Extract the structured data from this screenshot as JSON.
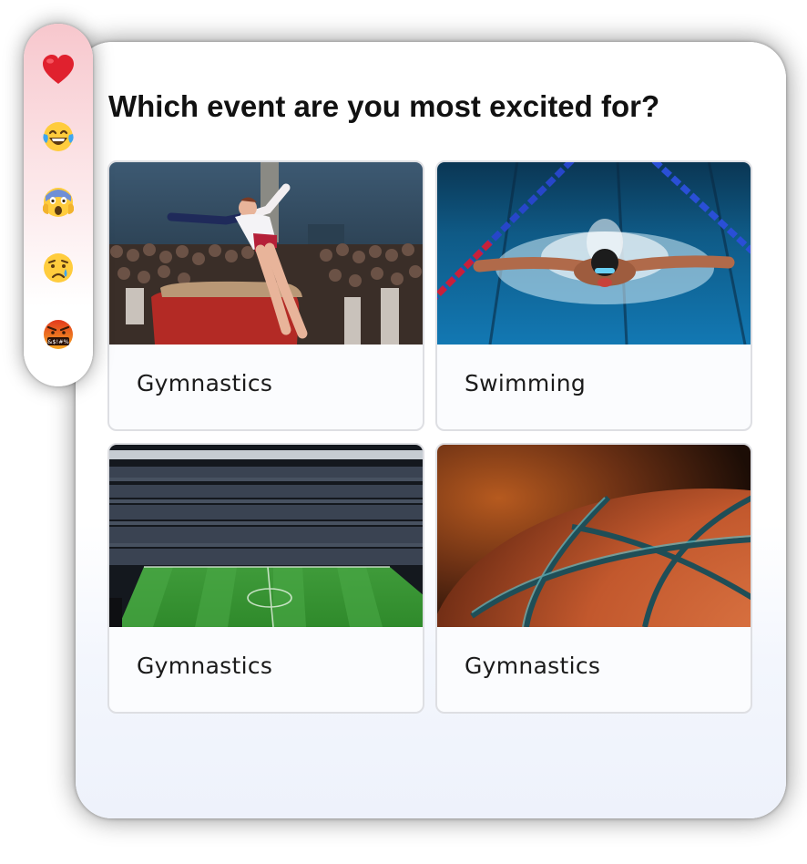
{
  "poll": {
    "question": "Which event are you most excited for?",
    "options": [
      {
        "label": "Gymnastics",
        "image": "gymnast-vault-photo"
      },
      {
        "label": "Swimming",
        "image": "butterfly-swimmer-photo"
      },
      {
        "label": "Gymnastics",
        "image": "soccer-stadium-photo"
      },
      {
        "label": "Gymnastics",
        "image": "basketball-closeup-photo"
      }
    ]
  },
  "reactions": [
    {
      "name": "heart-emoji"
    },
    {
      "name": "laughing-tears-emoji"
    },
    {
      "name": "screaming-emoji"
    },
    {
      "name": "crying-emoji"
    },
    {
      "name": "cursing-emoji",
      "text": "&$!#%"
    }
  ],
  "colors": {
    "reaction_bar_top": "#f7c7cd",
    "card_border": "#dedfe3",
    "text": "#111111"
  }
}
